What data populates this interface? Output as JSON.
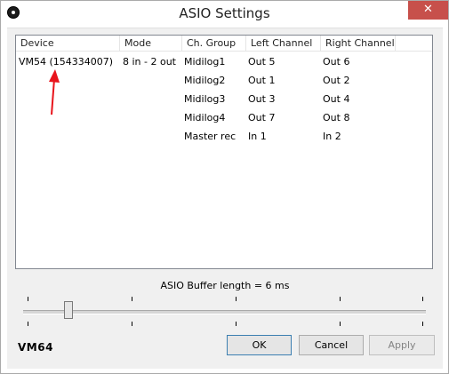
{
  "window": {
    "title": "ASIO Settings",
    "close_glyph": "✕"
  },
  "list": {
    "columns": [
      "Device",
      "Mode",
      "Ch. Group",
      "Left Channel",
      "Right Channel"
    ],
    "device": "VM54 (154334007)",
    "mode": "8 in - 2 out",
    "rows": [
      {
        "group": "Midilog1",
        "left": "Out 5",
        "right": "Out 6"
      },
      {
        "group": "Midilog2",
        "left": "Out 1",
        "right": "Out 2"
      },
      {
        "group": "Midilog3",
        "left": "Out 3",
        "right": "Out 4"
      },
      {
        "group": "Midilog4",
        "left": "Out 7",
        "right": "Out 8"
      },
      {
        "group": "Master rec",
        "left": "In 1",
        "right": "In 2"
      }
    ]
  },
  "buffer": {
    "label": "ASIO Buffer length = 6 ms",
    "slider_position": 0.11
  },
  "logo": "VM64",
  "buttons": {
    "ok": "OK",
    "cancel": "Cancel",
    "apply": "Apply"
  },
  "colors": {
    "close_button": "#c7504b",
    "annotation_arrow": "#e8141c"
  },
  "icons": {
    "app": "circle-dot-icon",
    "close": "close-icon",
    "annotation": "red-arrow-icon"
  }
}
